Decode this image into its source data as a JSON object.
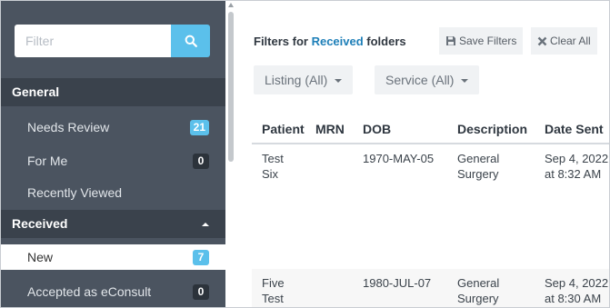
{
  "sidebar": {
    "filter_placeholder": "Filter",
    "sections": {
      "general": "General",
      "received": "Received"
    },
    "items": [
      {
        "label": "Needs Review",
        "badge": "21"
      },
      {
        "label": "For Me",
        "badge": "0"
      },
      {
        "label": "Recently Viewed",
        "badge": ""
      },
      {
        "label": "New",
        "badge": "7"
      },
      {
        "label": "Accepted as eConsult",
        "badge": "0"
      }
    ]
  },
  "main": {
    "filters_prefix": "Filters for ",
    "filters_highlight": "Received",
    "filters_suffix": " folders",
    "save_filters": "Save Filters",
    "clear_all": "Clear All",
    "listing_select": "Listing (All)",
    "service_select": "Service (All)",
    "columns": [
      "Patient",
      "MRN",
      "DOB",
      "Description",
      "Date Sent"
    ],
    "rows": [
      {
        "patient_1": "Test",
        "patient_2": "Six",
        "mrn": "",
        "dob": "1970-MAY-05",
        "desc_1": "General",
        "desc_2": "Surgery",
        "date_1": "Sep 4, 2022",
        "date_2": "at 8:32 AM"
      },
      {
        "patient_1": "Five",
        "patient_2": "Test",
        "mrn": "",
        "dob": "1980-JUL-07",
        "desc_1": "General",
        "desc_2": "Surgery",
        "date_1": "Sep 4, 2022",
        "date_2": "at 8:30 AM"
      }
    ]
  },
  "colors": {
    "sidebar_bg": "#4b5460",
    "section_bg": "#3a424c",
    "accent": "#5bc0eb",
    "link": "#1e7fb8"
  },
  "icons": {
    "search": "search-icon",
    "save": "floppy-disk-icon",
    "clear": "x-icon",
    "collapse": "caret-up-icon",
    "dropdown": "caret-down-icon"
  }
}
